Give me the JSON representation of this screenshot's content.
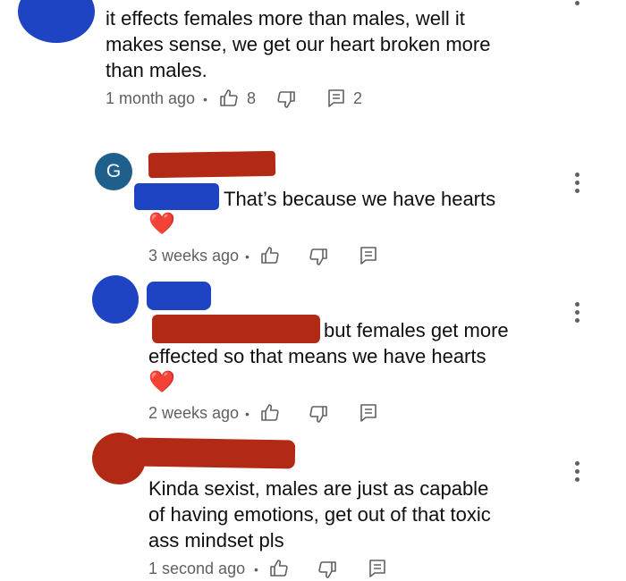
{
  "colors": {
    "redaction_red": "#b22a16",
    "redaction_blue": "#1e44c4",
    "avatar_g": "#1f5f8b",
    "meta_gray": "#606060"
  },
  "comments": [
    {
      "lines": [
        "it effects females more than males, well it",
        "makes sense, we get our heart broken more",
        "than males."
      ],
      "time": "1 month ago",
      "likes": "8",
      "replies": "2"
    },
    {
      "avatar_letter": "G",
      "text": "That’s because we have hearts",
      "emoji": "❤️",
      "time": "3 weeks ago"
    },
    {
      "text_line1": "but females get more",
      "text_line2": "effected so that means we have hearts",
      "emoji": "❤️",
      "time": "2 weeks ago"
    },
    {
      "lines": [
        "Kinda sexist, males are just as capable",
        "of having emotions, get out of that toxic",
        "ass mindset pls"
      ],
      "time": "1 second ago"
    }
  ],
  "icons": {
    "like": "thumbs-up-icon",
    "dislike": "thumbs-down-icon",
    "reply": "reply-icon",
    "menu": "more-vert-icon"
  }
}
